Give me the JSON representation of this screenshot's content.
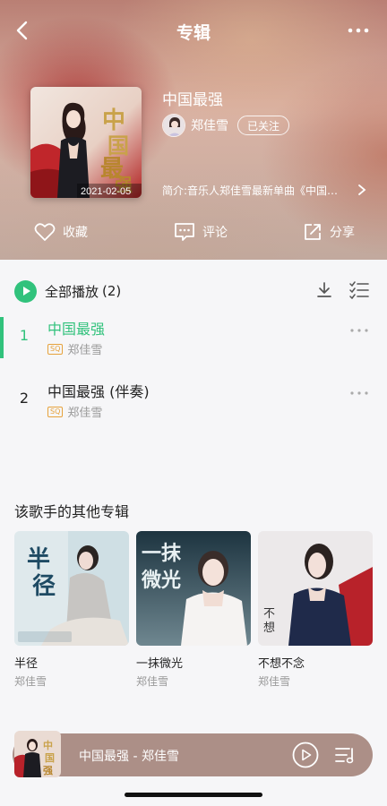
{
  "nav": {
    "title": "专辑",
    "back_icon": "chevron-left-icon",
    "more_icon": "more-horizontal-icon"
  },
  "album": {
    "title": "中国最强",
    "cover_date": "2021-02-05",
    "artist": "郑佳雪",
    "follow_label": "已关注",
    "intro": "简介:音乐人郑佳雪最新单曲《中国…"
  },
  "actions": {
    "favorite": "收藏",
    "comment": "评论",
    "share": "分享"
  },
  "play_all": {
    "label": "全部播放",
    "count": "(2)"
  },
  "songs": [
    {
      "index": "1",
      "title": "中国最强",
      "badge": "SQ",
      "artist": "郑佳雪",
      "active": true
    },
    {
      "index": "2",
      "title": "中国最强 (伴奏)",
      "badge": "SQ",
      "artist": "郑佳雪",
      "active": false
    }
  ],
  "other_albums": {
    "title": "该歌手的其他专辑",
    "items": [
      {
        "name": "半径",
        "artist": "郑佳雪"
      },
      {
        "name": "一抹微光",
        "artist": "郑佳雪"
      },
      {
        "name": "不想不念",
        "artist": "郑佳雪"
      }
    ]
  },
  "mini_player": {
    "title": "中国最强 - 郑佳雪"
  },
  "colors": {
    "accent": "#31c27c",
    "sq_badge": "#e6a23c",
    "mini_player_bg": "#ac8f87"
  }
}
